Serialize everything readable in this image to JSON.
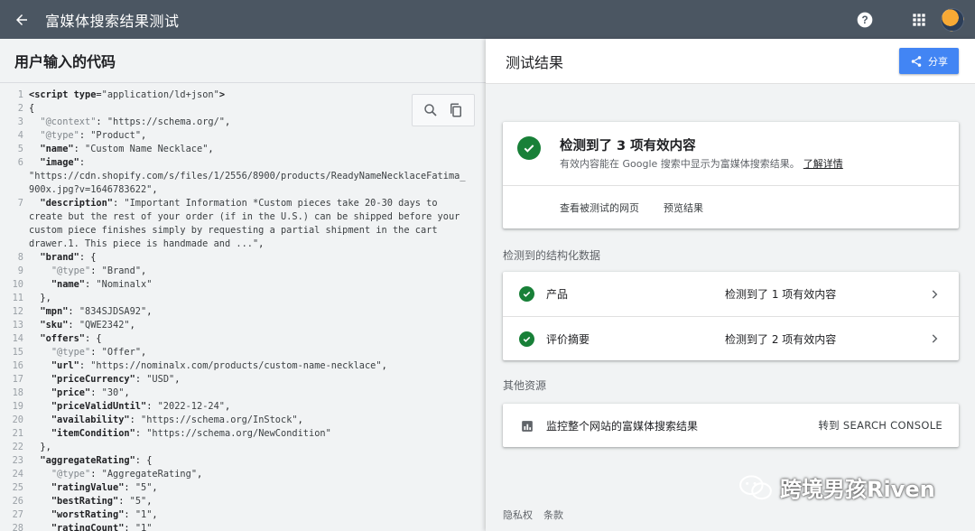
{
  "topbar": {
    "title": "富媒体搜索结果测试"
  },
  "left": {
    "header": "用户输入的代码",
    "code_lines": [
      {
        "n": "1",
        "html": "<span class='k'>&lt;script</span> <span class='k'>type</span>=<span class='s'>\"application/ld+json\"</span><span class='k'>&gt;</span>"
      },
      {
        "n": "2",
        "html": "<span class='p'>{</span>"
      },
      {
        "n": "3",
        "html": "  <span class='m'>\"@context\"</span>: <span class='s'>\"https://schema.org/\"</span>,"
      },
      {
        "n": "4",
        "html": "  <span class='m'>\"@type\"</span>: <span class='s'>\"Product\"</span>,"
      },
      {
        "n": "5",
        "html": "  <span class='k'>\"name\"</span>: <span class='s'>\"Custom Name Necklace\"</span>,"
      },
      {
        "n": "6",
        "html": "  <span class='k'>\"image\"</span>:"
      },
      {
        "n": "",
        "html": "<span class='s'>\"https://cdn.shopify.com/s/files/1/2556/8900/products/ReadyNameNecklaceFatima_</span>"
      },
      {
        "n": "",
        "html": "<span class='s'>900x.jpg?v=1646783622\"</span>,"
      },
      {
        "n": "7",
        "html": "  <span class='k'>\"description\"</span>: <span class='s'>\"Important Information *Custom pieces take 20-30 days to</span>"
      },
      {
        "n": "",
        "html": "<span class='s'>create but the rest of your order (if in the U.S.) can be shipped before your</span>"
      },
      {
        "n": "",
        "html": "<span class='s'>custom piece finishes simply by requesting a partial shipment in the cart</span>"
      },
      {
        "n": "",
        "html": "<span class='s'>drawer.1. This piece is handmade and ...\"</span>,"
      },
      {
        "n": "8",
        "html": "  <span class='k'>\"brand\"</span>: {"
      },
      {
        "n": "9",
        "html": "    <span class='m'>\"@type\"</span>: <span class='s'>\"Brand\"</span>,"
      },
      {
        "n": "10",
        "html": "    <span class='k'>\"name\"</span>: <span class='s'>\"Nominalx\"</span>"
      },
      {
        "n": "11",
        "html": "  },"
      },
      {
        "n": "12",
        "html": "  <span class='k'>\"mpn\"</span>: <span class='s'>\"834SJDSA92\"</span>,"
      },
      {
        "n": "13",
        "html": "  <span class='k'>\"sku\"</span>: <span class='s'>\"QWE2342\"</span>,"
      },
      {
        "n": "14",
        "html": "  <span class='k'>\"offers\"</span>: {"
      },
      {
        "n": "15",
        "html": "    <span class='m'>\"@type\"</span>: <span class='s'>\"Offer\"</span>,"
      },
      {
        "n": "16",
        "html": "    <span class='k'>\"url\"</span>: <span class='s'>\"https://nominalx.com/products/custom-name-necklace\"</span>,"
      },
      {
        "n": "17",
        "html": "    <span class='k'>\"priceCurrency\"</span>: <span class='s'>\"USD\"</span>,"
      },
      {
        "n": "18",
        "html": "    <span class='k'>\"price\"</span>: <span class='s'>\"30\"</span>,"
      },
      {
        "n": "19",
        "html": "    <span class='k'>\"priceValidUntil\"</span>: <span class='s'>\"2022-12-24\"</span>,"
      },
      {
        "n": "20",
        "html": "    <span class='k'>\"availability\"</span>: <span class='s'>\"https://schema.org/InStock\"</span>,"
      },
      {
        "n": "21",
        "html": "    <span class='k'>\"itemCondition\"</span>: <span class='s'>\"https://schema.org/NewCondition\"</span>"
      },
      {
        "n": "22",
        "html": "  },"
      },
      {
        "n": "23",
        "html": "  <span class='k'>\"aggregateRating\"</span>: {"
      },
      {
        "n": "24",
        "html": "    <span class='m'>\"@type\"</span>: <span class='s'>\"AggregateRating\"</span>,"
      },
      {
        "n": "25",
        "html": "    <span class='k'>\"ratingValue\"</span>: <span class='s'>\"5\"</span>,"
      },
      {
        "n": "26",
        "html": "    <span class='k'>\"bestRating\"</span>: <span class='s'>\"5\"</span>,"
      },
      {
        "n": "27",
        "html": "    <span class='k'>\"worstRating\"</span>: <span class='s'>\"1\"</span>,"
      },
      {
        "n": "28",
        "html": "    <span class='k'>\"ratingCount\"</span>: <span class='s'>\"1\"</span>"
      }
    ]
  },
  "right": {
    "header": "测试结果",
    "share_label": "分享",
    "summary": {
      "headline": "检测到了 3 项有效内容",
      "sub": "有效内容能在 Google 搜索中显示为富媒体搜索结果。",
      "learn_more": "了解详情",
      "action_view_page": "查看被测试的网页",
      "action_preview": "预览结果"
    },
    "structured_label": "检测到的结构化数据",
    "items": [
      {
        "label": "产品",
        "status": "检测到了 1 项有效内容"
      },
      {
        "label": "评价摘要",
        "status": "检测到了 2 项有效内容"
      }
    ],
    "other_label": "其他资源",
    "resource": {
      "label": "监控整个网站的富媒体搜索结果",
      "link": "转到 SEARCH CONSOLE"
    },
    "footer": {
      "privacy": "隐私权",
      "terms": "条款"
    }
  },
  "watermark": "跨境男孩Riven"
}
